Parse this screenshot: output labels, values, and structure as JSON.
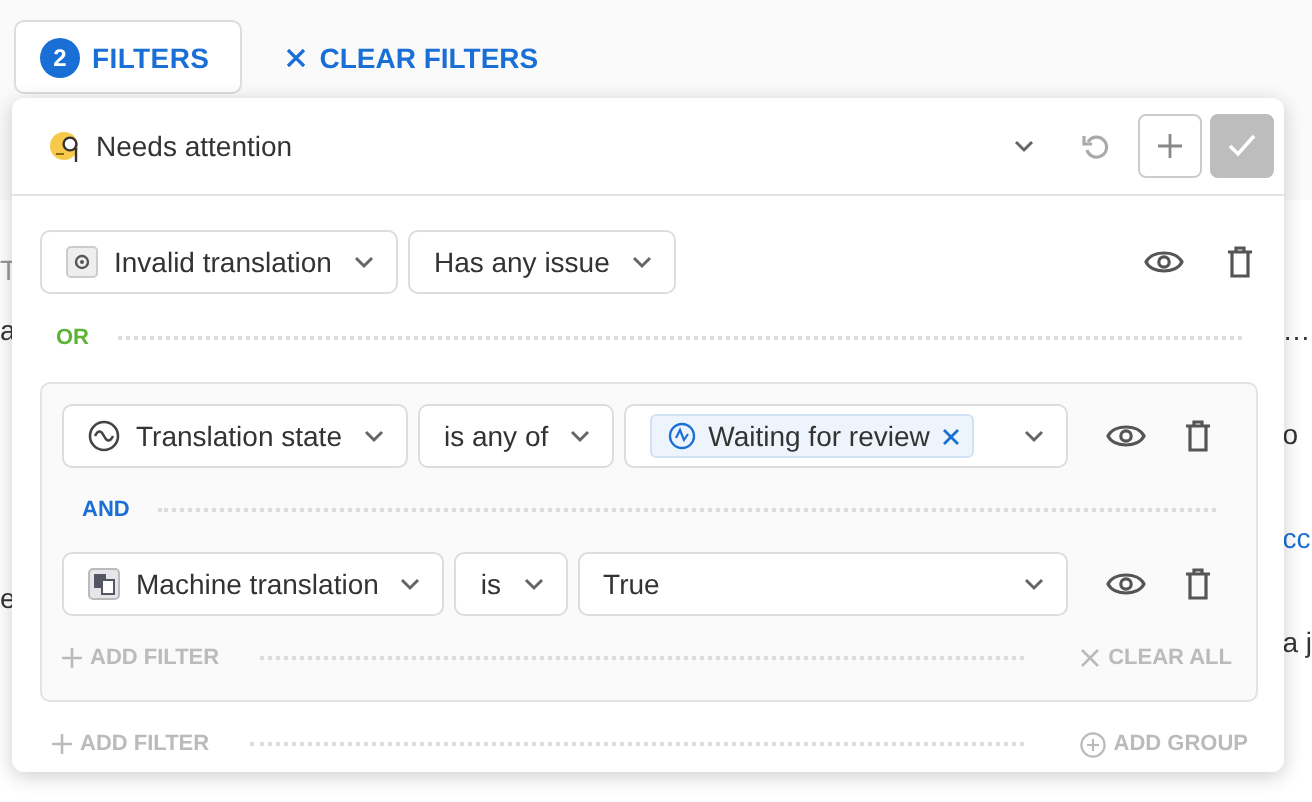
{
  "toolbar": {
    "filters_button": {
      "count": "2",
      "label": "FILTERS"
    },
    "clear_filters": "CLEAR FILTERS"
  },
  "background": {
    "left": [
      "T",
      "a",
      "e"
    ],
    "right": [
      "…",
      "o",
      "cc",
      "a j"
    ]
  },
  "popup": {
    "preset": "Needs attention",
    "conditions": [
      {
        "kind": "filter",
        "field": "Invalid translation",
        "operator": "Has any issue"
      },
      {
        "kind": "connector",
        "label": "OR"
      },
      {
        "kind": "group",
        "items": [
          {
            "kind": "filter",
            "field": "Translation state",
            "operator": "is any of",
            "value": {
              "kind": "chips",
              "chips": [
                "Waiting for review"
              ]
            }
          },
          {
            "kind": "connector",
            "label": "AND"
          },
          {
            "kind": "filter",
            "field": "Machine translation",
            "operator": "is",
            "value": {
              "kind": "text",
              "text": "True"
            }
          }
        ],
        "add_filter": "ADD FILTER",
        "clear_all": "CLEAR ALL"
      }
    ],
    "add_filter": "ADD FILTER",
    "add_group": "ADD GROUP"
  }
}
